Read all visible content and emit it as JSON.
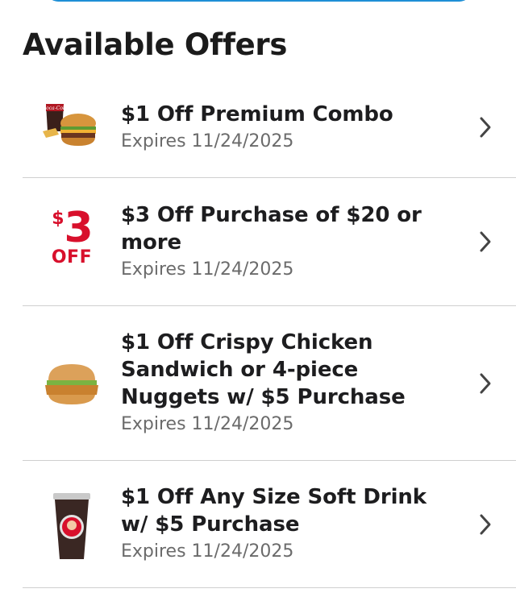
{
  "page": {
    "title": "Available Offers"
  },
  "offers": [
    {
      "name": "$1 Off Premium Combo",
      "expiry": "Expires 11/24/2025",
      "icon": "combo-meal-icon"
    },
    {
      "name": "$3 Off Purchase of $20 or more",
      "expiry": "Expires 11/24/2025",
      "icon": "three-dollars-off-icon",
      "badge": {
        "dollar": "$",
        "amount": "3",
        "off": "OFF"
      }
    },
    {
      "name": "$1 Off Crispy Chicken Sandwich or 4-piece Nuggets w/ $5 Purchase",
      "expiry": "Expires 11/24/2025",
      "icon": "chicken-sandwich-icon"
    },
    {
      "name": "$1 Off Any Size Soft Drink w/ $5 Purchase",
      "expiry": "Expires 11/24/2025",
      "icon": "soft-drink-cup-icon"
    }
  ],
  "colors": {
    "accent": "#1e8fd6",
    "badge_red": "#d8102c",
    "divider": "#cfcfcf",
    "secondary_text": "#6b6b6b"
  }
}
